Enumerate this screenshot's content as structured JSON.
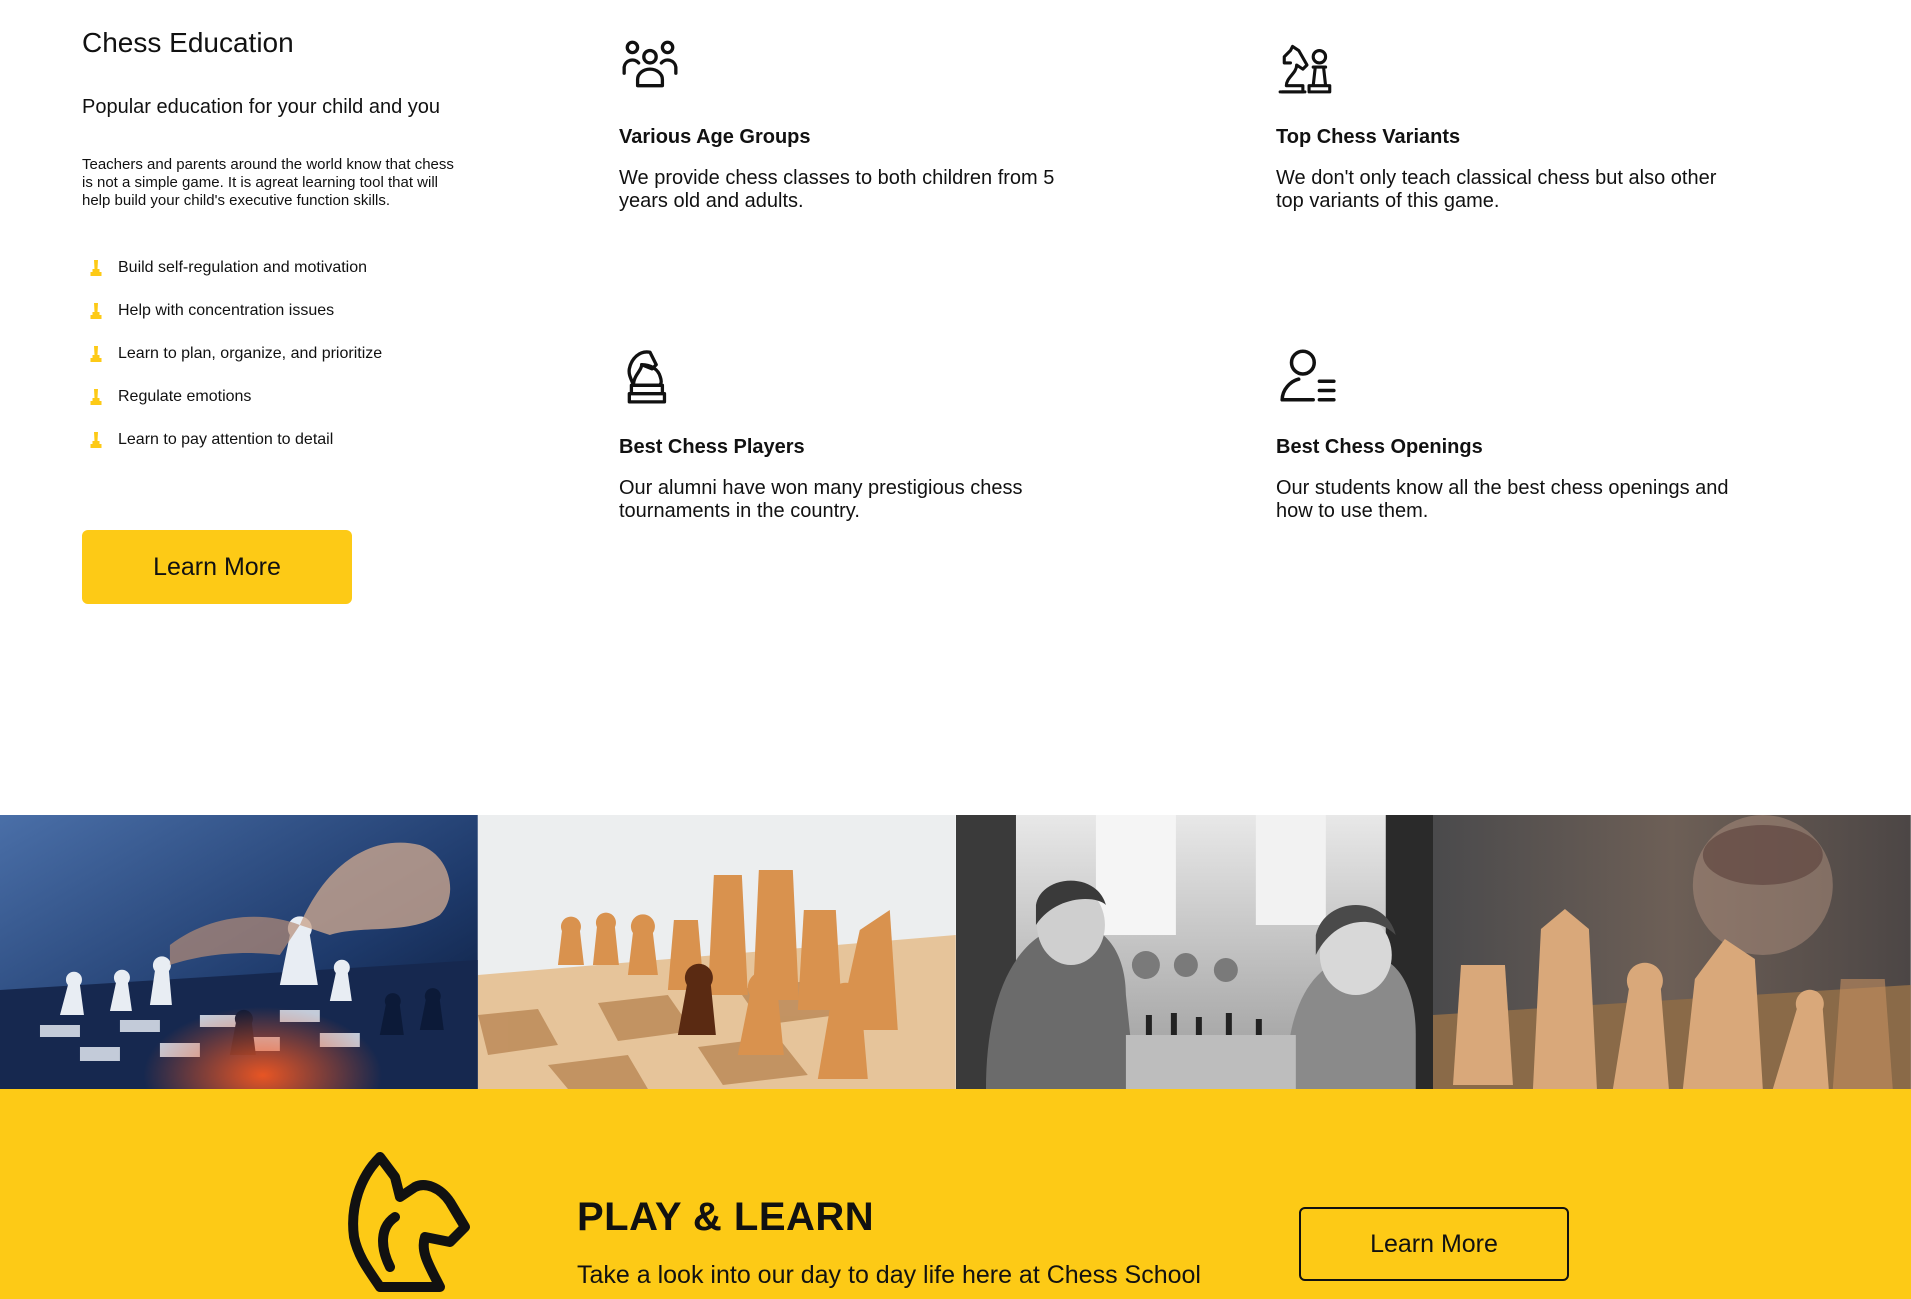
{
  "education": {
    "title": "Chess Education",
    "subtitle": "Popular education for your child and you",
    "description": "Teachers and parents around the world know that chess is not a simple game. It is agreat learning tool that will help build your child's executive function skills.",
    "bullets": [
      "Build self-regulation and motivation",
      "Help with concentration issues",
      "Learn to plan, organize, and prioritize",
      "Regulate emotions",
      "Learn to pay attention to detail"
    ],
    "button_label": "Learn More"
  },
  "features": [
    {
      "icon": "people-group-icon",
      "title": "Various Age Groups",
      "text": "We provide chess classes to both children from 5 years old and adults."
    },
    {
      "icon": "chess-knight-pawn-icon",
      "title": "Top Chess Variants",
      "text": "We don't only teach classical chess but also other top variants of this game."
    },
    {
      "icon": "chess-knight-icon",
      "title": "Best Chess Players",
      "text": "Our alumni have won many prestigious chess tournaments in the country."
    },
    {
      "icon": "user-list-icon",
      "title": "Best Chess Openings",
      "text": "Our students know all the best chess openings and how to use them."
    }
  ],
  "gallery": [
    {
      "name": "hand-moving-chess-piece-photo"
    },
    {
      "name": "wooden-chess-pieces-photo"
    },
    {
      "name": "children-playing-chess-photo"
    },
    {
      "name": "chess-pieces-child-background-photo"
    }
  ],
  "banner": {
    "title": "PLAY & LEARN",
    "text": "Take a look into our day to day life here at Chess School",
    "button_label": "Learn More"
  },
  "colors": {
    "accent": "#fdca16",
    "text": "#111111",
    "background": "#ffffff"
  }
}
